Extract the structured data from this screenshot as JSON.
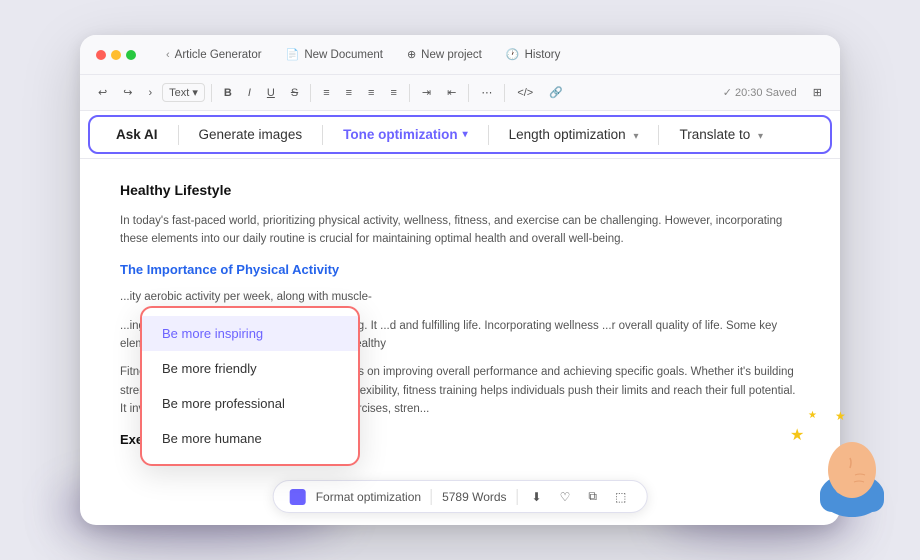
{
  "titlebar": {
    "tabs": [
      {
        "id": "article-generator",
        "label": "Article Generator",
        "icon": "←"
      },
      {
        "id": "new-document",
        "label": "New Document",
        "icon": "📄"
      },
      {
        "id": "new-project",
        "label": "New project",
        "icon": "⊕"
      },
      {
        "id": "history",
        "label": "History",
        "icon": "🕐"
      }
    ]
  },
  "toolbar": {
    "undo": "↩",
    "redo": "↪",
    "text_dropdown": "Text ▾",
    "bold": "B",
    "italic": "I",
    "underline": "U",
    "strikethrough": "S",
    "align_left": "≡",
    "align_center": "≡",
    "align_right": "≡",
    "justify": "≡",
    "indent": "⇥",
    "outdent": "⇤",
    "more": "⋯",
    "code": "</>",
    "link": "🔗",
    "saved": "✓ 20:30 Saved",
    "grid": "⊞"
  },
  "ai_toolbar": {
    "ask_ai": "Ask AI",
    "generate_images": "Generate images",
    "tone_optimization": "Tone optimization",
    "length_optimization": "Length optimization",
    "translate_to": "Translate to"
  },
  "document": {
    "title": "Healthy Lifestyle",
    "para1": "In today's fast-paced world, prioritizing physical activity, wellness, fitness, and exercise can be challenging. However, incorporating these elements into our daily routine is crucial for maintaining optimal health and overall well-being.",
    "heading1": "The Importance of Physical Activity",
    "para2": "...ity aerobic activity per week, along with muscle-",
    "para3": "...ing physical, mental, and emotional well-being. It ...d and fulfilling life. Incorporating wellness ...r overall quality of life. Some key elements of ...dquate sleep, and maintaining healthy",
    "para4": "Fitness goes beyond physical activity. It focuses on improving overall performance and achieving specific goals. Whether it's building strength, increasing endurance, or enhancing flexibility, fitness training helps individuals push their limits and reach their full potential. It involves a combination of cardiovascular exercises, stren...",
    "heading2": "Exercise: A Key Component of Fitness"
  },
  "tone_dropdown": {
    "items": [
      {
        "id": "inspiring",
        "label": "Be more inspiring",
        "active": true
      },
      {
        "id": "friendly",
        "label": "Be more friendly",
        "active": false
      },
      {
        "id": "professional",
        "label": "Be more professional",
        "active": false
      },
      {
        "id": "humane",
        "label": "Be more humane",
        "active": false
      }
    ]
  },
  "bottom_bar": {
    "icon_label": "Format optimization",
    "word_count": "5789 Words",
    "actions": [
      "⬇",
      "♡",
      "⬚",
      "⬚"
    ]
  },
  "colors": {
    "accent": "#6c63ff",
    "dropdown_border": "#f87171",
    "active_text": "#6c63ff"
  }
}
